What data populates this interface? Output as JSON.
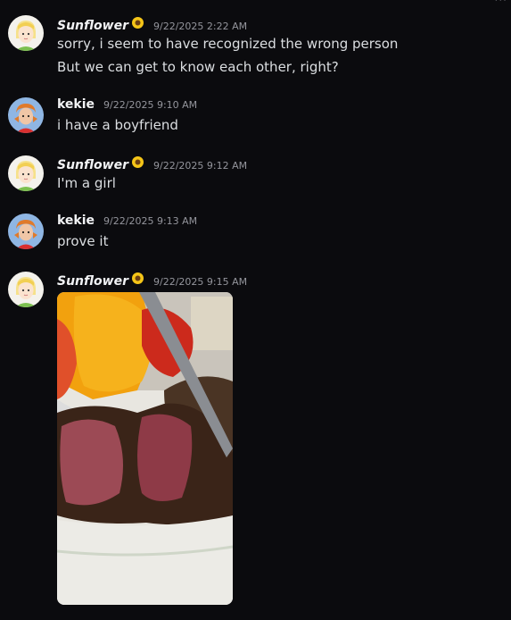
{
  "more_indicator": "···",
  "messages": [
    {
      "user": "Sunflower",
      "time": "9/22/2025 2:22 AM",
      "lines": [
        "sorry, i seem to have recognized the wrong person",
        "But we can get to know each other, right?"
      ]
    },
    {
      "user": "kekie",
      "time": "9/22/2025 9:10 AM",
      "lines": [
        "i have a boyfriend"
      ]
    },
    {
      "user": "Sunflower",
      "time": "9/22/2025 9:12 AM",
      "lines": [
        "I'm a girl"
      ]
    },
    {
      "user": "kekie",
      "time": "9/22/2025 9:13 AM",
      "lines": [
        "prove it"
      ]
    },
    {
      "user": "Sunflower",
      "time": "9/22/2025 9:15 AM",
      "attachment_icon": "photo-of-steak-and-peppers"
    }
  ],
  "colors": {
    "background": "#0b0b0e",
    "username": "#f2f3f5",
    "timestamp": "#94959c",
    "text": "#dbdee1"
  }
}
